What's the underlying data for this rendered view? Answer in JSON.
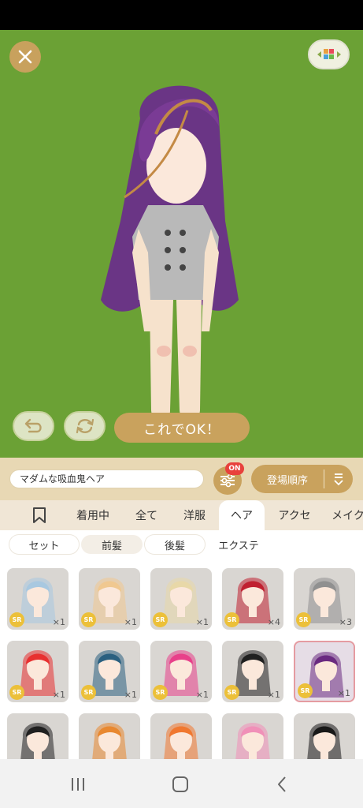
{
  "header": {
    "close_icon": "close-icon",
    "background_icon": "color-grid-icon"
  },
  "actions": {
    "undo_icon": "undo-icon",
    "rotate_icon": "rotate-icon",
    "ok_label": "これでOK！"
  },
  "controls": {
    "name_value": "マダムな吸血鬼ヘア",
    "filter_badge": "ON",
    "sort_label": "登場順序"
  },
  "tabs": [
    {
      "label": "",
      "icon": "bookmark-icon"
    },
    {
      "label": "着用中"
    },
    {
      "label": "全て"
    },
    {
      "label": "洋服"
    },
    {
      "label": "ヘア",
      "active": true
    },
    {
      "label": "アクセ"
    },
    {
      "label": "メイク"
    }
  ],
  "subtabs": [
    {
      "label": "セット"
    },
    {
      "label": "前髪",
      "selected": true
    },
    {
      "label": "後髪"
    },
    {
      "label": "エクステ"
    }
  ],
  "items": [
    {
      "rarity": "SR",
      "qty": "×1",
      "hair": "#a8c8e0"
    },
    {
      "rarity": "SR",
      "qty": "×1",
      "hair": "#f0c890"
    },
    {
      "rarity": "SR",
      "qty": "×1",
      "hair": "#e8d8a8"
    },
    {
      "rarity": "SR",
      "qty": "×4",
      "hair": "#c02030"
    },
    {
      "rarity": "SR",
      "qty": "×3",
      "hair": "#909090"
    },
    {
      "rarity": "SR",
      "qty": "×1",
      "hair": "#e83030"
    },
    {
      "rarity": "SR",
      "qty": "×1",
      "hair": "#2a6080"
    },
    {
      "rarity": "SR",
      "qty": "×1",
      "hair": "#e8408a"
    },
    {
      "rarity": "SR",
      "qty": "×1",
      "hair": "#202020"
    },
    {
      "rarity": "SR",
      "qty": "×1",
      "hair": "#6a2a80",
      "selected": true
    },
    {
      "rarity": "",
      "qty": "",
      "hair": "#202020"
    },
    {
      "rarity": "",
      "qty": "",
      "hair": "#e88830"
    },
    {
      "rarity": "",
      "qty": "",
      "hair": "#f07830"
    },
    {
      "rarity": "",
      "qty": "",
      "hair": "#f090b8"
    },
    {
      "rarity": "",
      "qty": "",
      "hair": "#181818"
    }
  ],
  "nav": {
    "recent_icon": "recent-apps-icon",
    "home_icon": "home-icon",
    "back_icon": "back-icon"
  },
  "colors": {
    "stage_green": "#6ba135",
    "gold": "#c9a25d",
    "beige": "#e8d8b4",
    "badge_red": "#e8413c",
    "sr_gold": "#ecc039"
  }
}
